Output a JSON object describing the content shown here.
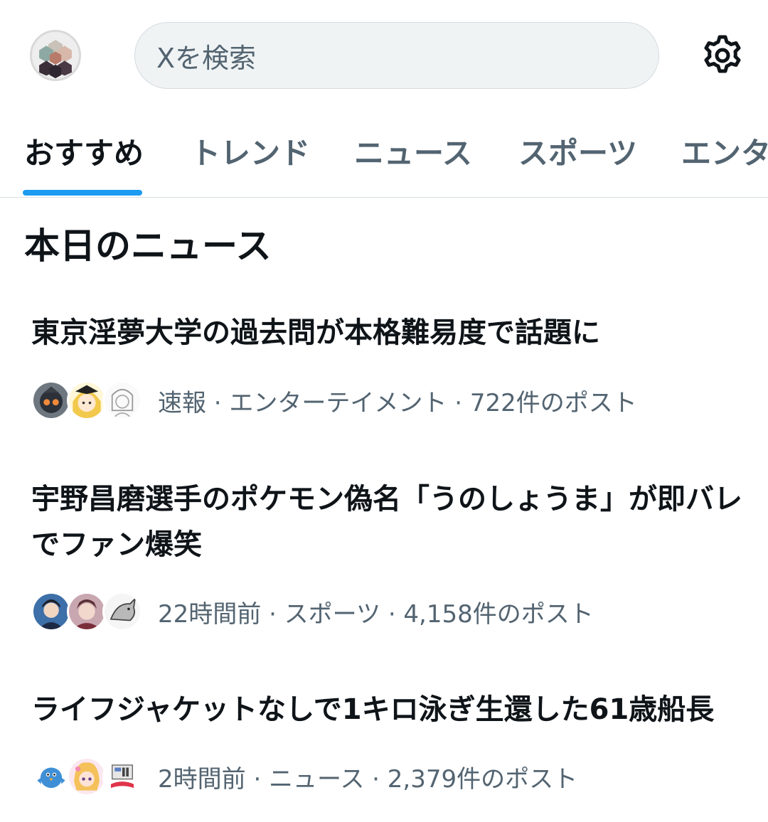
{
  "header": {
    "avatar_icon": "account-avatar",
    "search_placeholder": "Xを検索",
    "settings_icon": "gear-icon"
  },
  "tabs": [
    {
      "label": "おすすめ",
      "active": true
    },
    {
      "label": "トレンド",
      "active": false
    },
    {
      "label": "ニュース",
      "active": false
    },
    {
      "label": "スポーツ",
      "active": false
    },
    {
      "label": "エンタ",
      "active": false
    }
  ],
  "section": {
    "title": "本日のニュース"
  },
  "news": [
    {
      "title": "東京淫夢大学の過去問が本格難易度で話題に",
      "meta": "速報 · エンターテイメント · 722件のポスト"
    },
    {
      "title": "宇野昌磨選手のポケモン偽名「うのしょうま」が即バレでファン爆笑",
      "meta": "22時間前 · スポーツ · 4,158件のポスト"
    },
    {
      "title": "ライフジャケットなしで1キロ泳ぎ生還した61歳船長",
      "meta": "2時間前 · ニュース · 2,379件のポスト"
    }
  ],
  "colors": {
    "accent": "#1d9bf0",
    "text_primary": "#0f1419",
    "text_secondary": "#536471",
    "search_bg": "#eff3f4"
  }
}
